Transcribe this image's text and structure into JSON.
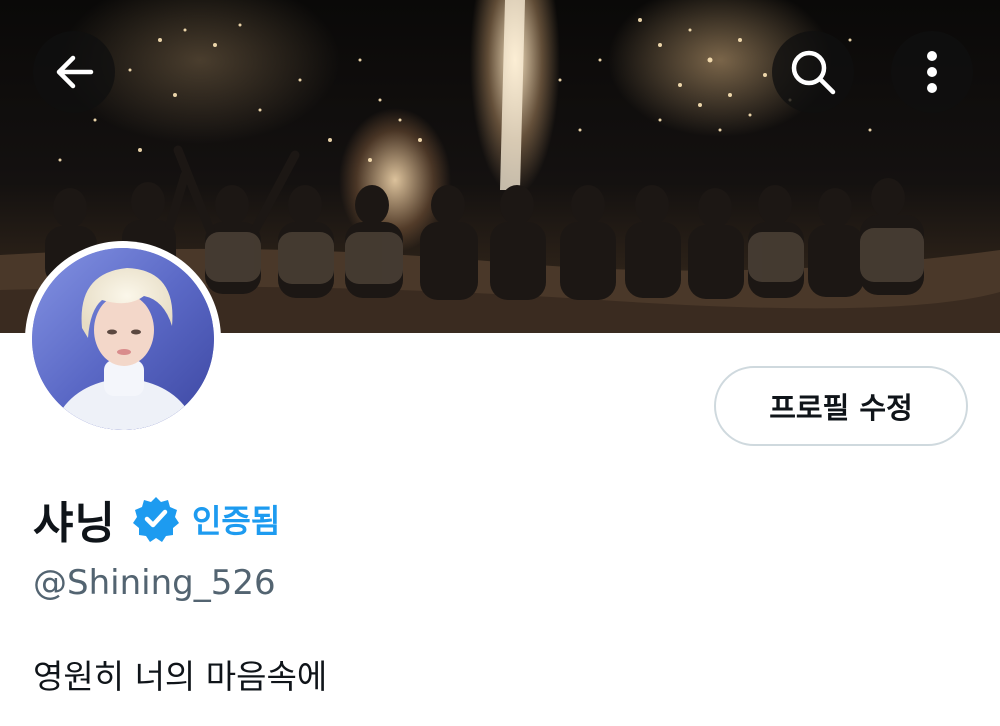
{
  "header": {
    "back_icon": "arrow-left-icon",
    "search_icon": "search-icon",
    "more_icon": "more-vertical-icon"
  },
  "profile": {
    "edit_button_label": "프로필 수정",
    "display_name": "샤닝",
    "verified_label": "인증됨",
    "handle": "@Shining_526",
    "bio": "영원히 너의 마음속에"
  },
  "colors": {
    "accent": "#1d9bf0",
    "text_primary": "#0f1419",
    "text_secondary": "#536471",
    "border": "#cfd9de"
  }
}
